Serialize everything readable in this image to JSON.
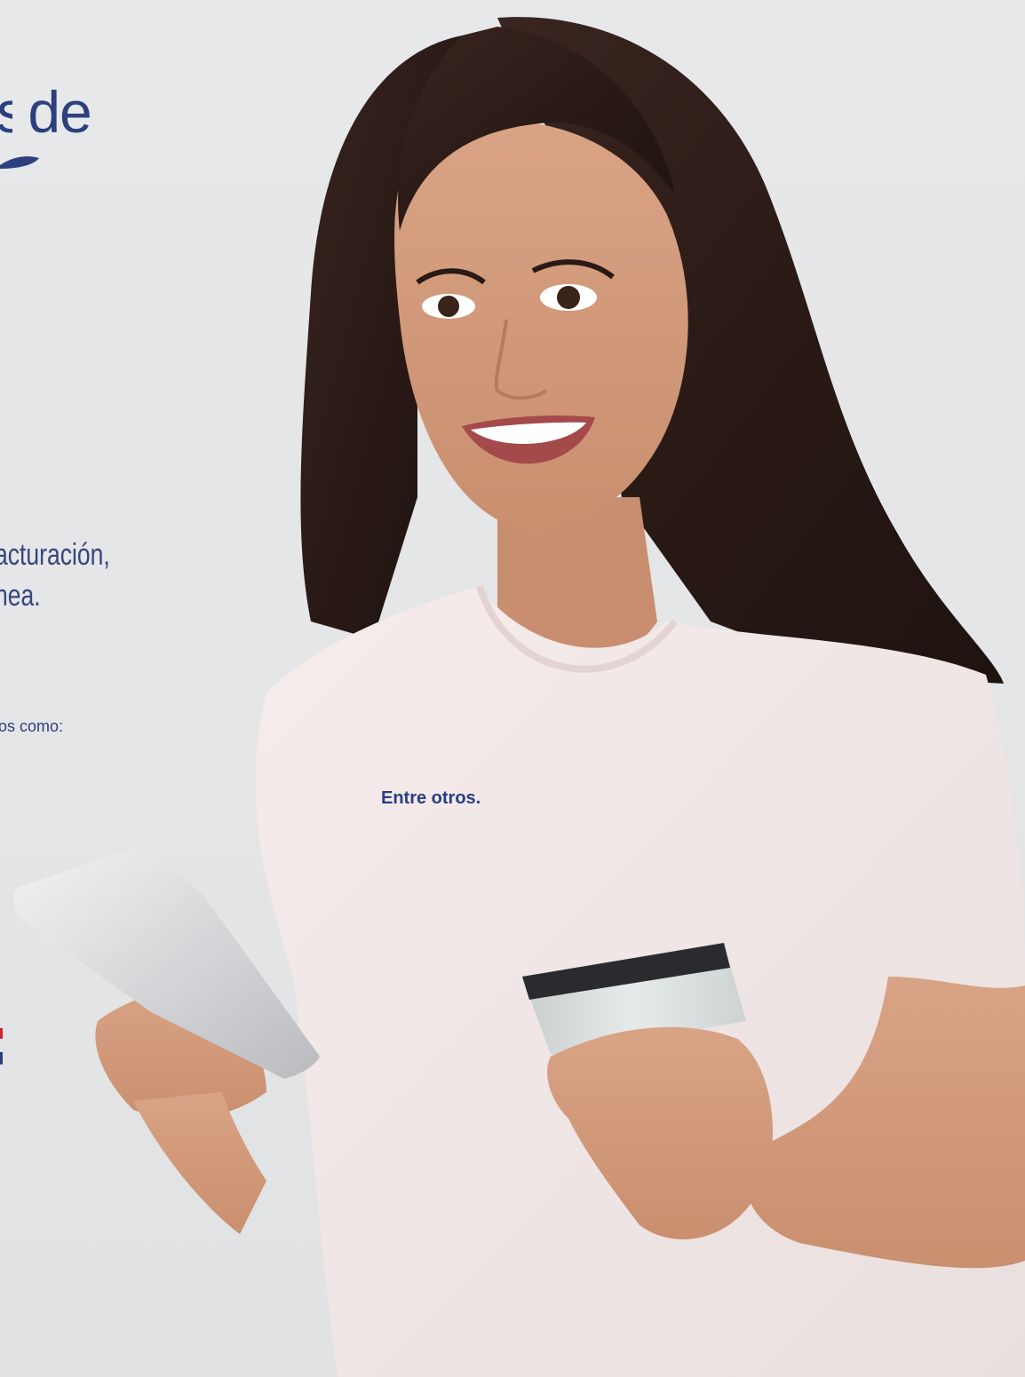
{
  "headline": {
    "partial_glyph": "s",
    "word": "de"
  },
  "body_text": {
    "line1": "acturación,",
    "line2": "nea."
  },
  "intro_text": "os como:",
  "list_footer": "Entre otros.",
  "colors": {
    "navy": "#2d3f7e",
    "red_accent": "#d0232a",
    "background": "#e5e6e8"
  },
  "photo": {
    "subject": "smiling woman holding smartphone and credit card"
  }
}
